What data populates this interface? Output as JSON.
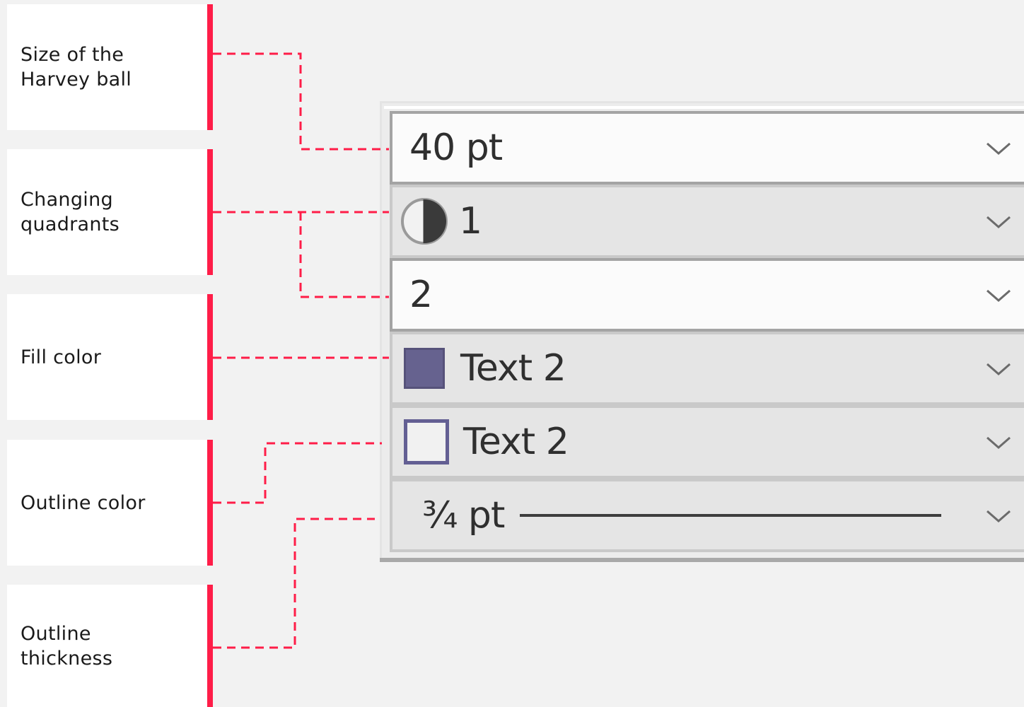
{
  "labels": [
    {
      "id": "size",
      "text": "Size of the\nHarvey ball"
    },
    {
      "id": "quadrants",
      "text": "Changing\nquadrants"
    },
    {
      "id": "fill",
      "text": "Fill color"
    },
    {
      "id": "outline_color",
      "text": "Outline color"
    },
    {
      "id": "outline_thickness",
      "text": "Outline\nthickness"
    }
  ],
  "panel": {
    "size_value": "40 pt",
    "quadrant_value": "1",
    "quadrant_icon": "half-filled-circle-icon",
    "quadrant_total": "2",
    "fill_color_name": "Text 2",
    "fill_color": "#66628f",
    "outline_color_name": "Text 2",
    "outline_color": "#635f93",
    "thickness_value": "¾ pt",
    "dropdown_icon": "chevron-down-icon"
  },
  "colors": {
    "accent": "#ff1d48",
    "background": "#f2f2f2",
    "card": "#ffffff"
  }
}
